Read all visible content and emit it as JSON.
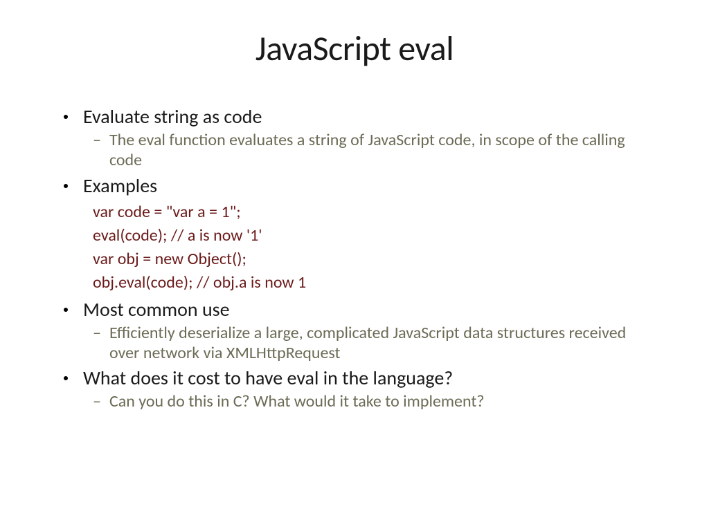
{
  "title": "JavaScript eval",
  "bullets": {
    "b1": {
      "label": "Evaluate string as code",
      "sub1": "The eval function evaluates a string of JavaScript code, in scope of the calling code"
    },
    "b2": {
      "label": "Examples",
      "code1": "var code = \"var a = 1\";",
      "code2": "eval(code); // a is now '1'",
      "code3": "var obj = new Object();",
      "code4": "obj.eval(code); // obj.a is now 1"
    },
    "b3": {
      "label": "Most common use",
      "sub1": "Efficiently deserialize a large, complicated JavaScript data structures received over network via XMLHttpRequest"
    },
    "b4": {
      "label": "What does it cost to have eval in the language?",
      "sub1": "Can you do this in C?   What would it take to implement?"
    }
  }
}
